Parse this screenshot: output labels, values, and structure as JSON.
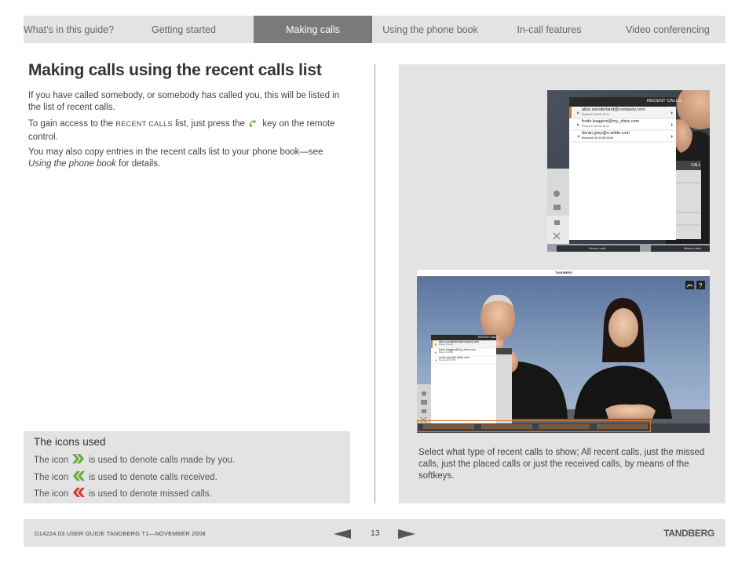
{
  "nav": {
    "tabs": [
      {
        "label": "What’s in this guide?",
        "active": false
      },
      {
        "label": "Getting started",
        "active": false
      },
      {
        "label": "Making calls",
        "active": true
      },
      {
        "label": "Using the phone book",
        "active": false
      },
      {
        "label": "In-call features",
        "active": false
      },
      {
        "label": "Video conferencing",
        "active": false
      }
    ]
  },
  "main": {
    "title": "Making calls using the recent calls list",
    "para1": "If you have called somebody, or somebody has called you, this will be listed in the list of recent calls.",
    "para2_before": "To gain access to the",
    "para2_keyword": "RECENT CALLS",
    "para2_middle": "list, just press the",
    "para2_after": "key on the remote control.",
    "para3_before": "You may also copy entries in the recent calls list to your phone book—see",
    "para3_link": "Using the phone book",
    "para3_after": "for details."
  },
  "icons_box": {
    "title": "The icons used",
    "rows": [
      {
        "prefix": "The icon",
        "suffix": "is used to denote calls made by you.",
        "icon": "placed-call-chevron-icon",
        "color": "#6aa83a"
      },
      {
        "prefix": "The icon",
        "suffix": "is used to denote calls received.",
        "icon": "received-call-chevron-icon",
        "color": "#6aa83a"
      },
      {
        "prefix": "The icon",
        "suffix": "is used to denote missed calls.",
        "icon": "missed-call-chevron-icon",
        "color": "#d63a2e"
      }
    ]
  },
  "screenshot_zoom": {
    "header": "RECENT CALLS",
    "side_label": "CALL",
    "entries": [
      {
        "name": "alice.wonderland@company.com",
        "detail": "Placed 15.10.08 16.21"
      },
      {
        "name": "frodo.baggins@my_shire.com",
        "detail": "Placed 16.10.08 16.41"
      },
      {
        "name": "doran.grey@o.wilde.com",
        "detail": "Received 15.10.08 15.46"
      }
    ],
    "softkeys": [
      "Recent calls",
      "Missed calls"
    ]
  },
  "screenshot_full": {
    "brand": "TANDBERG",
    "header": "RECENT CALLS",
    "entries": [
      {
        "name": "alice.wonderland@company.com",
        "detail": "Placed 15.10.08"
      },
      {
        "name": "frodo.baggins@my_shire.com",
        "detail": "Placed 16.10.08"
      },
      {
        "name": "doran.grey@o.wilde.com",
        "detail": "Received 15.10.08"
      }
    ]
  },
  "caption": "Select what type of recent calls to show; All recent calls, just the missed calls, just the placed calls or just the received calls, by means of the softkeys.",
  "footer": {
    "doc_id": "D14224.03 USER GUIDE TANDBERG T1—NOVEMBER 2008",
    "page_number": "13",
    "logo": "TANDBERG"
  },
  "colors": {
    "nav_bg": "#e3e3e3",
    "nav_active": "#7a7a7a",
    "accent_orange": "#e0782a",
    "placed_green": "#6aa83a",
    "missed_red": "#d63a2e"
  }
}
